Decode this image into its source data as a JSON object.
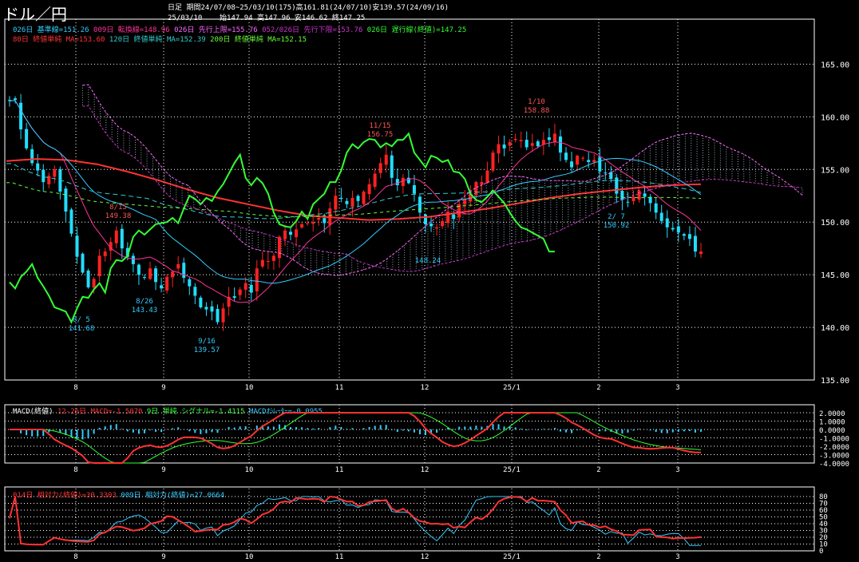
{
  "header": {
    "title": "ドル／円",
    "timeframe": "日足",
    "period": "期間24/07/08~25/03/10(175)高161.81(24/07/10)安139.57(24/09/16)",
    "date": "25/03/10",
    "ohlc": "始147.94 高147.96 安146.62 終147.25"
  },
  "legend_main": {
    "row1": [
      {
        "text": "026日 基準線=151.26",
        "color": "#33ccff"
      },
      {
        "text": "009日 転換線=148.96",
        "color": "#ff3399"
      },
      {
        "text": "026日 先行上限=155.76",
        "color": "#ff66ff"
      },
      {
        "text": "052/026日 先行下限=153.76",
        "color": "#cc33cc"
      },
      {
        "text": "026日 遅行線(終値)=147.25",
        "color": "#33ff33"
      }
    ],
    "row2": [
      {
        "text": "80日 終値単純 MA=153.60",
        "color": "#ff3333"
      },
      {
        "text": "120日 終値単純 MA=152.39",
        "color": "#33cccc"
      },
      {
        "text": "200日 終値単純 MA=152.15",
        "color": "#66ff33"
      }
    ]
  },
  "legend_macd": [
    {
      "text": "MACD(終値)",
      "color": "#ffffff"
    },
    {
      "text": "12-26日 MACD=-1.5070",
      "color": "#ff3333"
    },
    {
      "text": "9日 単純 シグナル=-1.4115",
      "color": "#33ff33"
    },
    {
      "text": "MACDｵｼﾚｰﾀｰ=-0.0955",
      "color": "#33ccff"
    }
  ],
  "legend_rsi": [
    {
      "text": "014日 相対力(終値)=30.3303",
      "color": "#ff3333"
    },
    {
      "text": "009日 相対力(終値)=27.0664",
      "color": "#33ccff"
    }
  ],
  "colors": {
    "up": "#ff2222",
    "down": "#22ddff",
    "kijun": "#33ccff",
    "tenkan": "#ff3399",
    "spanA": "#ff66ff",
    "spanB": "#cc33cc",
    "chikou": "#33ff33",
    "ma80": "#ff3333",
    "ma120": "#33cccc",
    "ma200": "#66ff33",
    "grid": "#ffffff"
  },
  "chart_data": [
    {
      "type": "candlestick",
      "title": "ドル／円",
      "ylim": [
        135,
        167
      ],
      "y_ticks": [
        "165.00",
        "160.00",
        "155.00",
        "150.00",
        "145.00",
        "140.00",
        "135.00"
      ],
      "x_ticks": [
        "8",
        "9",
        "10",
        "11",
        "12",
        "25/1",
        "2",
        "3"
      ],
      "annotations": [
        {
          "label": "8/ 5",
          "value": "141.68"
        },
        {
          "label": "8/15",
          "value": "149.38"
        },
        {
          "label": "8/26",
          "value": "143.43"
        },
        {
          "label": "9/16",
          "value": "139.57"
        },
        {
          "label": "11/15",
          "value": "156.75"
        },
        {
          "label": "1/10",
          "value": "158.88"
        },
        {
          "label": "2/ 7",
          "value": "150.92"
        },
        {
          "label": "",
          "value": "148.24"
        }
      ],
      "series": [
        {
          "name": "終値",
          "values": [
            161.5,
            161.6,
            158.8,
            157.0,
            155.6,
            154.9,
            153.8,
            154.4,
            155.0,
            152.9,
            151.0,
            148.9,
            146.7,
            145.2,
            143.8,
            144.6,
            146.8,
            147.2,
            148.1,
            149.2,
            147.5,
            146.7,
            146.0,
            145.0,
            144.7,
            145.6,
            144.3,
            143.7,
            144.8,
            145.3,
            146.0,
            144.7,
            143.9,
            143.0,
            141.9,
            141.7,
            141.5,
            140.5,
            141.8,
            142.9,
            142.8,
            143.6,
            144.2,
            143.3,
            145.6,
            146.4,
            146.3,
            146.8,
            148.6,
            149.2,
            148.8,
            149.3,
            149.8,
            149.9,
            150.0,
            150.4,
            149.9,
            151.3,
            152.5,
            152.2,
            151.7,
            152.3,
            152.0,
            152.9,
            153.6,
            154.6,
            155.6,
            156.4,
            154.2,
            153.5,
            154.2,
            153.7,
            152.7,
            150.9,
            149.8,
            149.6,
            149.5,
            150.1,
            151.0,
            150.3,
            151.7,
            152.2,
            152.7,
            153.8,
            153.8,
            154.9,
            156.6,
            157.4,
            157.0,
            157.6,
            157.9,
            157.8,
            157.1,
            157.5,
            157.2,
            157.8,
            157.8,
            158.4,
            156.6,
            155.9,
            155.2,
            156.3,
            156.1,
            155.7,
            155.9,
            154.8,
            154.7,
            154.1,
            152.7,
            152.1,
            151.9,
            152.4,
            153.0,
            152.4,
            151.8,
            150.9,
            150.1,
            149.5,
            149.3,
            149.0,
            148.7,
            148.4,
            147.2,
            147.2
          ]
        },
        {
          "name": "MA80",
          "values": [
            155.8,
            156.0,
            155.9,
            155.5,
            154.8,
            154.0,
            153.1,
            152.3,
            151.7,
            151.1,
            150.6,
            150.4,
            150.2,
            150.3,
            150.5,
            150.9,
            151.3,
            151.8,
            152.3,
            152.7,
            153.0,
            153.3,
            153.5,
            153.6
          ]
        }
      ]
    },
    {
      "type": "line",
      "title": "MACD(終値)",
      "ylim": [
        -4,
        2
      ],
      "y_ticks": [
        "2.0000",
        "1.0000",
        "0.0000",
        "-1.0000",
        "-2.0000",
        "-3.0000",
        "-4.0000"
      ]
    },
    {
      "type": "line",
      "title": "相対力",
      "ylim": [
        0,
        80
      ],
      "y_ticks": [
        "80",
        "70",
        "60",
        "50",
        "40",
        "30",
        "20",
        "10",
        "0"
      ]
    }
  ]
}
